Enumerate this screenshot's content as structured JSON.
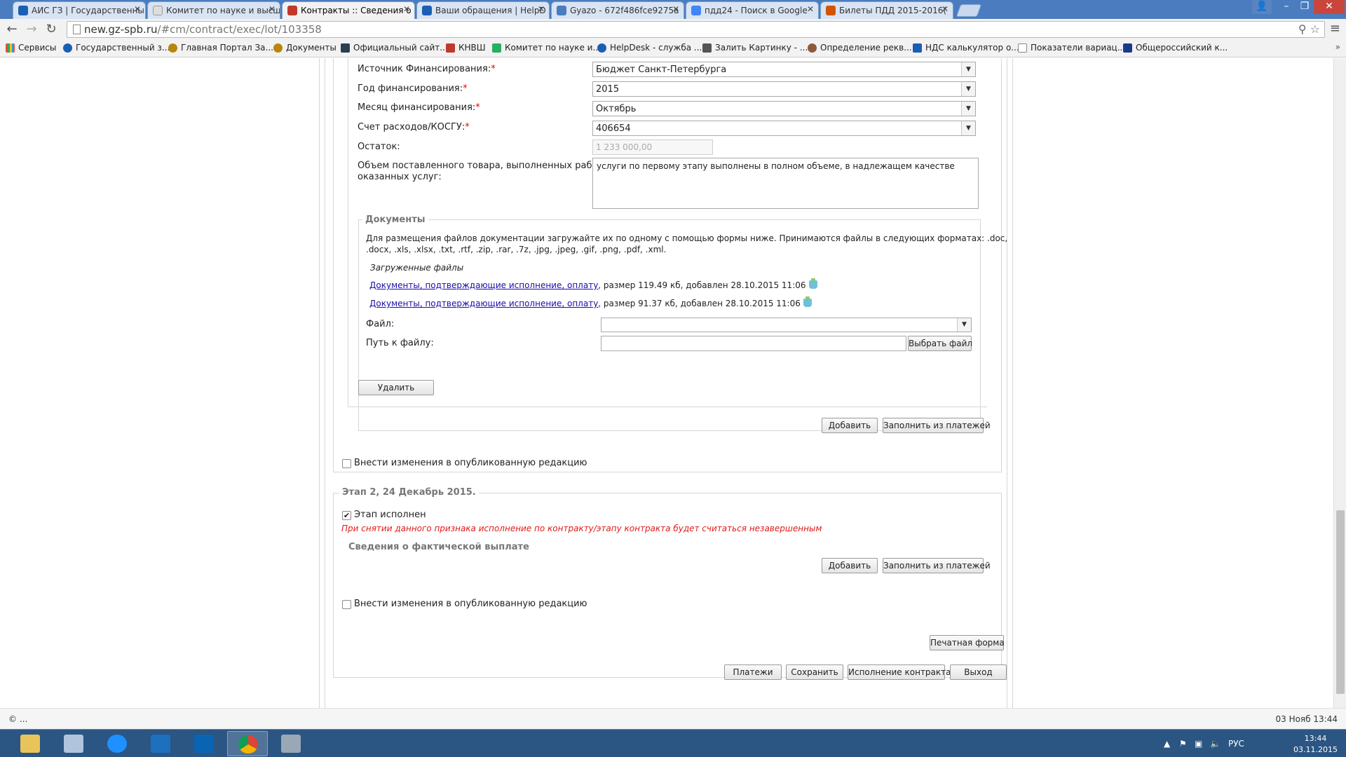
{
  "browser": {
    "tabs": [
      {
        "title": "АИС ГЗ | Государственны",
        "color": "#1a5fb4"
      },
      {
        "title": "Комитет по науке и высш",
        "color": "#dddddd"
      },
      {
        "title": "Контракты :: Сведения о",
        "color": "#c0392b",
        "active": true
      },
      {
        "title": "Ваши обращения | HelpD",
        "color": "#1a5fb4"
      },
      {
        "title": "Gyazo - 672f486fce9275a",
        "color": "#4a7cbf"
      },
      {
        "title": "пдд24 - Поиск в Google",
        "color": "#4285f4"
      },
      {
        "title": "Билеты ПДД 2015-2016(",
        "color": "#d35400"
      }
    ],
    "url_host": "new.gz-spb.ru",
    "url_path": "/#cm/contract/exec/lot/103358",
    "bookmarks": [
      {
        "label": "Сервисы",
        "color": "#e74c3c"
      },
      {
        "label": "Государственный з...",
        "color": "#1a5fb4"
      },
      {
        "label": "Главная Портал За...",
        "color": "#b8860b"
      },
      {
        "label": "Документы",
        "color": "#b8860b"
      },
      {
        "label": "Официальный сайт...",
        "color": "#2c3e50"
      },
      {
        "label": "КНВШ",
        "color": "#c0392b"
      },
      {
        "label": "Комитет по науке и...",
        "color": "#27ae60"
      },
      {
        "label": "HelpDesk - служба ...",
        "color": "#1a5fb4"
      },
      {
        "label": "Залить Картинку - ...",
        "color": "#555555"
      },
      {
        "label": "Определение рекв...",
        "color": "#8e5a3c"
      },
      {
        "label": "НДС калькулятор о...",
        "color": "#1a5fb4"
      },
      {
        "label": "Показатели вариац...",
        "color": "#ffffff"
      },
      {
        "label": "Общероссийский к...",
        "color": "#1a3a8a"
      }
    ],
    "bookmarks_more": "»"
  },
  "form": {
    "funding_source": {
      "label": "Источник Финансирования:",
      "value": "Бюджет Санкт-Петербурга"
    },
    "funding_year": {
      "label": "Год финансирования:",
      "value": "2015"
    },
    "funding_month": {
      "label": "Месяц финансирования:",
      "value": "Октябрь"
    },
    "account": {
      "label": "Счет расходов/КОСГУ:",
      "value": "406654"
    },
    "remainder": {
      "label": "Остаток:",
      "value": "1 233 000,00"
    },
    "volume": {
      "label_line1": "Объем поставленного товара, выполненных работ,",
      "label_line2": "оказанных услуг:",
      "value": "услуги по первому этапу выполнены в полном объеме, в надлежащем качестве"
    },
    "required_mark": "*"
  },
  "documents": {
    "legend": "Документы",
    "info_line1": "Для размещения файлов документации загружайте их по одному с помощью формы ниже. Принимаются файлы в следующих форматах: .doc,",
    "info_line2": ".docx, .xls, .xlsx, .txt, .rtf, .zip, .rar, .7z, .jpg, .jpeg, .gif, .png, .pdf, .xml.",
    "uploaded_title": "Загруженные файлы",
    "files": [
      {
        "name": "Документы, подтверждающие исполнение, оплату",
        "meta": ", размер 119.49 кб, добавлен 28.10.2015 11:06"
      },
      {
        "name": "Документы, подтверждающие исполнение, оплату",
        "meta": ", размер 91.37 кб, добавлен 28.10.2015 11:06"
      }
    ],
    "file_label": "Файл:",
    "path_label": "Путь к файлу:",
    "choose_file": "Выбрать файл",
    "delete": "Удалить"
  },
  "payments1": {
    "add": "Добавить",
    "fill": "Заполнить из платежей"
  },
  "publish1": "Внести изменения в опубликованную редакцию",
  "stage2": {
    "legend": "Этап 2, 24 Декабрь 2015.",
    "done_label": "Этап исполнен",
    "warning": "При снятии данного признака исполнение по контракту/этапу контракта будет считаться незавершенным",
    "subhead": "Сведения о фактической выплате",
    "add": "Добавить",
    "fill": "Заполнить из платежей",
    "publish": "Внести изменения в опубликованную редакцию"
  },
  "footer_buttons": {
    "print": "Печатная форма",
    "payments": "Платежи",
    "save": "Сохранить",
    "execution": "Исполнение контракта",
    "exit": "Выход"
  },
  "statusbar": {
    "left": "© ...",
    "right": "03 Нояб 13:44"
  },
  "taskbar": {
    "apps": [
      {
        "name": "file-explorer-icon",
        "color": "#e8c45a"
      },
      {
        "name": "calculator-icon",
        "color": "#b0c4de"
      },
      {
        "name": "internet-explorer-icon",
        "color": "#1e90ff"
      },
      {
        "name": "lync-icon",
        "color": "#1f6fbf"
      },
      {
        "name": "outlook-icon",
        "color": "#0a64b4"
      },
      {
        "name": "chrome-icon",
        "color": "#db4437",
        "active": true
      },
      {
        "name": "app-avatar-icon",
        "color": "#9aa7b6"
      }
    ],
    "lang": "РУС",
    "time": "13:44",
    "date": "03.11.2015"
  }
}
